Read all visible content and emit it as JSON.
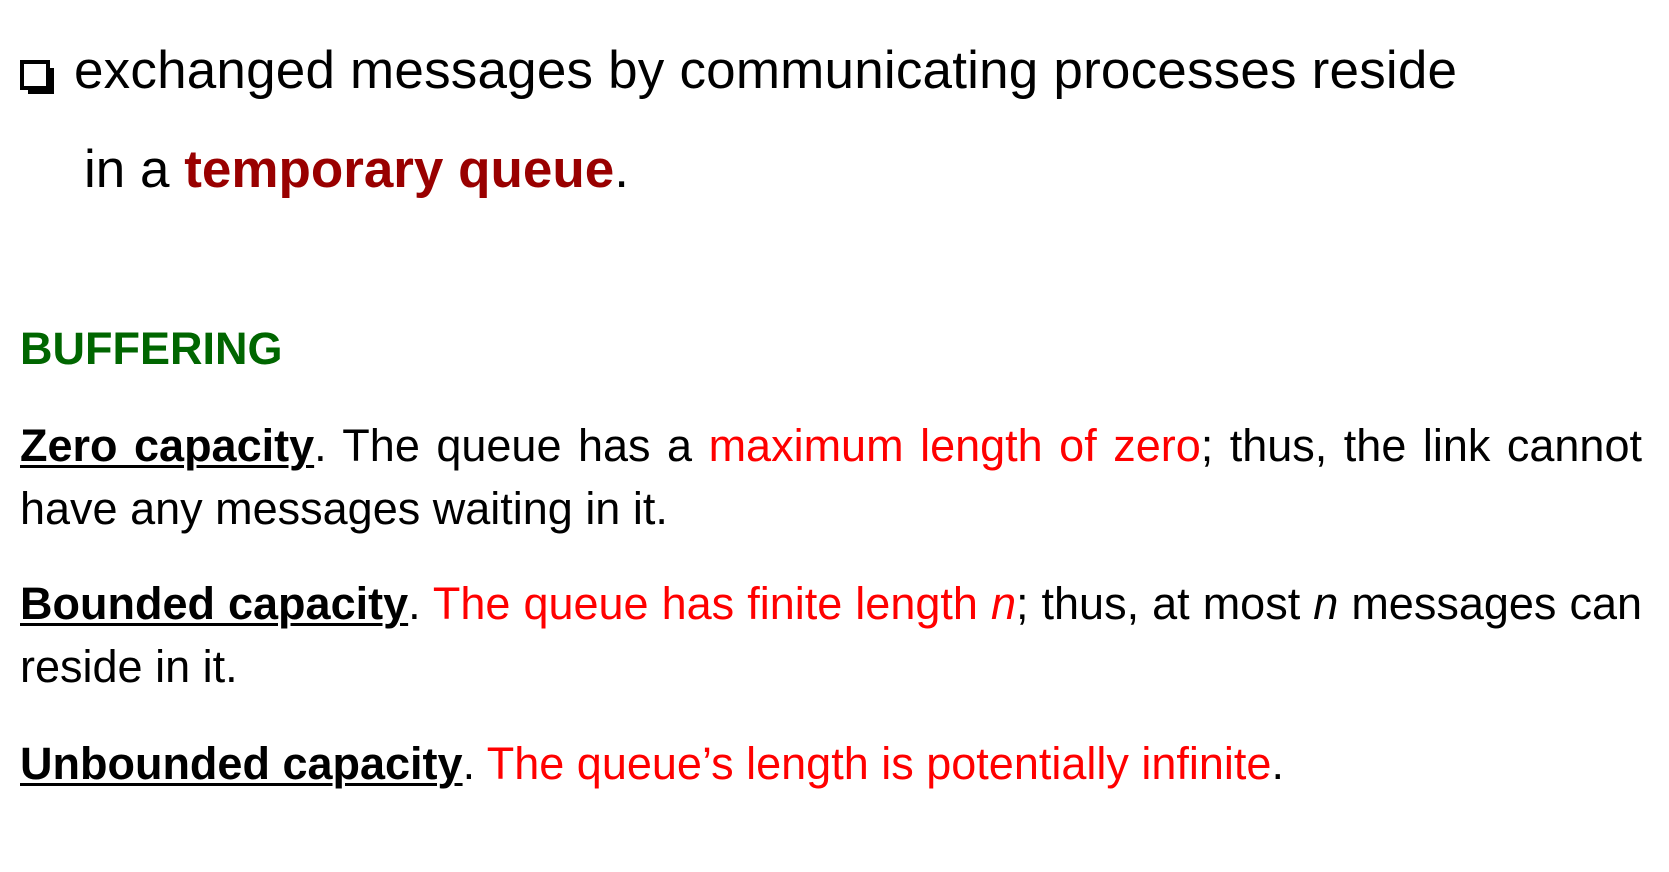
{
  "intro": {
    "line1": "exchanged messages by communicating processes reside",
    "line2_prefix": "in a ",
    "line2_highlight": "temporary queue",
    "line2_suffix": "."
  },
  "heading": "BUFFERING",
  "items": [
    {
      "term": "Zero capacity",
      "sep": ". The queue has a ",
      "red": "maximum length of zero",
      "rest": "; thus, the link cannot have any messages waiting in it."
    },
    {
      "term": "Bounded capacity",
      "sep": ". ",
      "red_a": "The queue has finite length ",
      "red_n": "n",
      "mid": "; thus, at most ",
      "n2": "n",
      "rest": " messages can reside in it."
    },
    {
      "term": "Unbounded capacity",
      "sep": ". ",
      "red": "The queue’s length is potentially infinite",
      "end": "."
    }
  ],
  "colors": {
    "heading": "#006600",
    "highlight": "#990000",
    "accent": "#ff0000"
  },
  "icons": {
    "bullet": "checkbox-bullet-icon"
  }
}
